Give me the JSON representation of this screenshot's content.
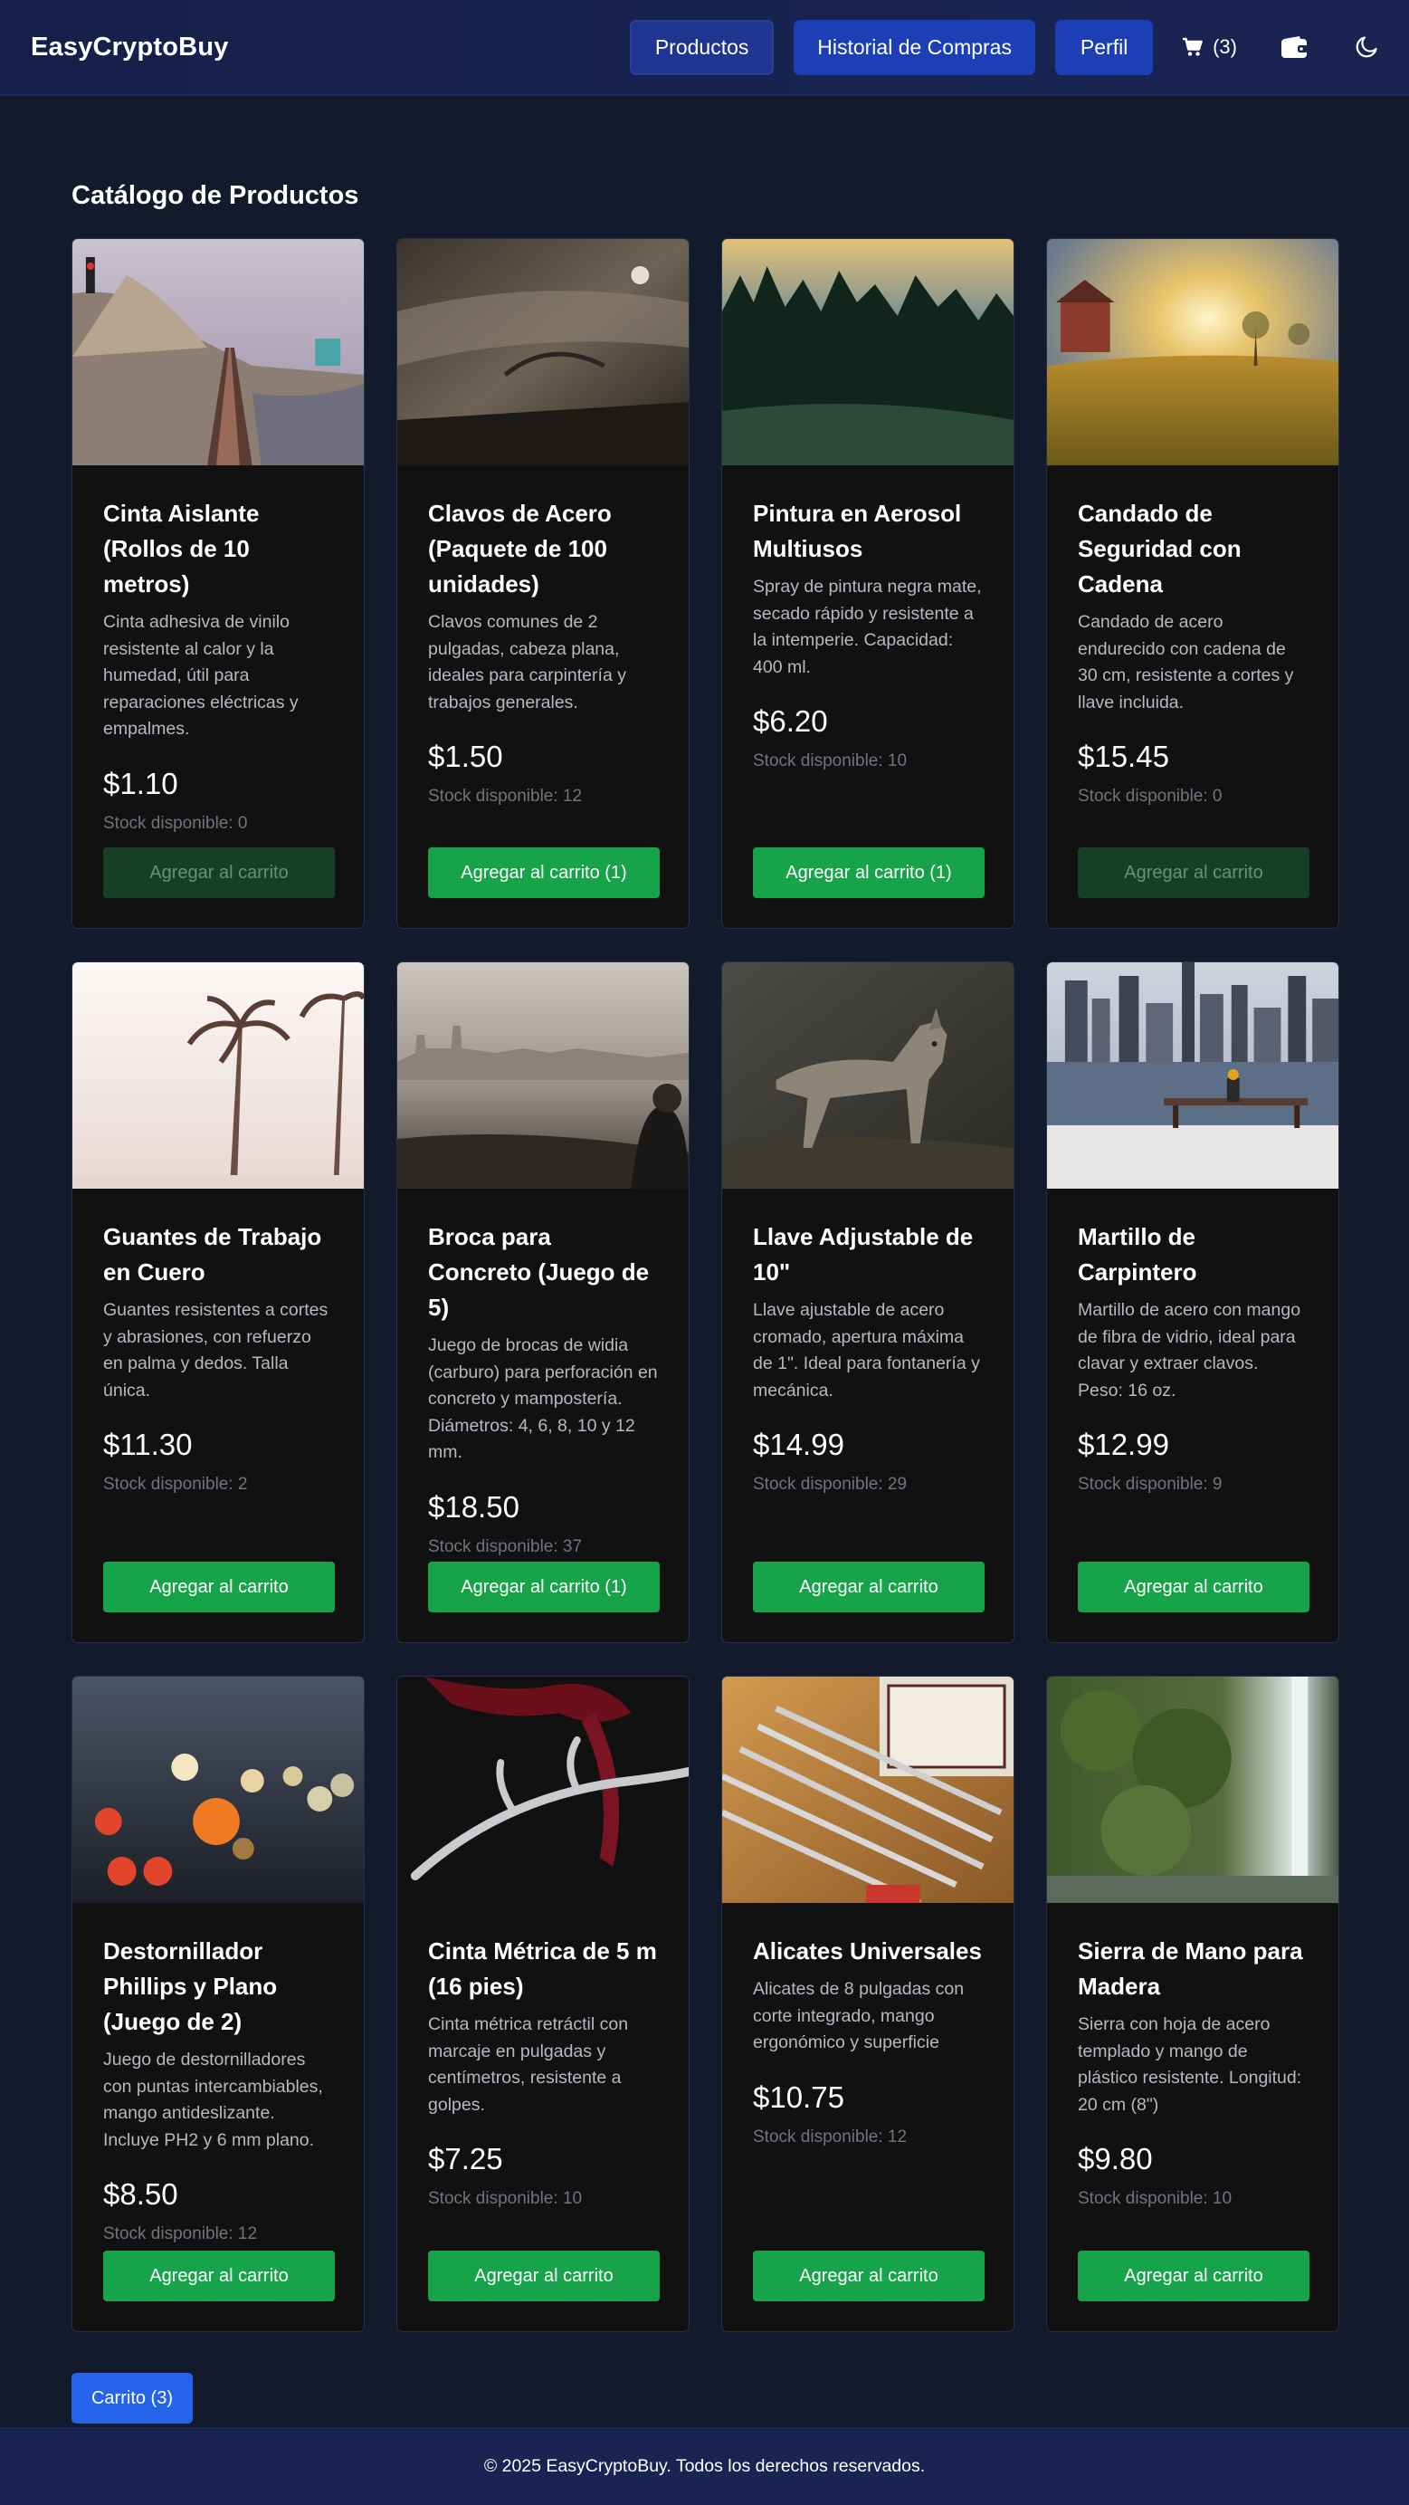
{
  "header": {
    "brand": "EasyCryptoBuy",
    "nav": {
      "products": "Productos",
      "history": "Historial de Compras",
      "profile": "Perfil"
    },
    "cart_count": "(3)",
    "cart_icon": "cart-icon",
    "wallet_icon": "wallet-icon",
    "theme_icon": "moon-icon"
  },
  "main": {
    "title": "Catálogo de Productos",
    "products": [
      {
        "name": "Cinta Aislante (Rollos de 10 metros)",
        "description": "Cinta adhesiva de vinilo resistente al calor y la humedad, útil para reparaciones eléctricas y empalmes.",
        "price": "$1.10",
        "stock": "Stock disponible: 0",
        "button": "Agregar al carrito",
        "disabled": true,
        "image": "railway-coast-photo"
      },
      {
        "name": "Clavos de Acero (Paquete de 100 unidades)",
        "description": "Clavos comunes de 2 pulgadas, cabeza plana, ideales para carpintería y trabajos generales.",
        "price": "$1.50",
        "stock": "Stock disponible: 12",
        "button": "Agregar al carrito (1)",
        "disabled": false,
        "image": "vintage-car-photo"
      },
      {
        "name": "Pintura en Aerosol Multiusos",
        "description": "Spray de pintura negra mate, secado rápido y resistente a la intemperie. Capacidad: 400 ml.",
        "price": "$6.20",
        "stock": "Stock disponible: 10",
        "button": "Agregar al carrito (1)",
        "disabled": false,
        "image": "forest-sunset-photo"
      },
      {
        "name": "Candado de Seguridad con Cadena",
        "description": "Candado de acero endurecido con cadena de 30 cm, resistente a cortes y llave incluida.",
        "price": "$15.45",
        "stock": "Stock disponible: 0",
        "button": "Agregar al carrito",
        "disabled": true,
        "image": "field-sunrise-photo"
      },
      {
        "name": "Guantes de Trabajo en Cuero",
        "description": "Guantes resistentes a cortes y abrasiones, con refuerzo en palma y dedos. Talla única.",
        "price": "$11.30",
        "stock": "Stock disponible: 2",
        "button": "Agregar al carrito",
        "disabled": false,
        "image": "palm-trees-photo"
      },
      {
        "name": "Broca para Concreto (Juego de 5)",
        "description": "Juego de brocas de widia (carburo) para perforación en concreto y mampostería. Diámetros: 4, 6, 8, 10 y 12 mm.",
        "price": "$18.50",
        "stock": "Stock disponible: 37",
        "button": "Agregar al carrito (1)",
        "disabled": false,
        "image": "city-shore-photo"
      },
      {
        "name": "Llave Adjustable de 10\"",
        "description": "Llave ajustable de acero cromado, apertura máxima de 1\". Ideal para fontanería y mecánica.",
        "price": "$14.99",
        "stock": "Stock disponible: 29",
        "button": "Agregar al carrito",
        "disabled": false,
        "image": "coyote-photo"
      },
      {
        "name": "Martillo de Carpintero",
        "description": "Martillo de acero con mango de fibra de vidrio, ideal para clavar y extraer clavos. Peso: 16 oz.",
        "price": "$12.99",
        "stock": "Stock disponible: 9",
        "button": "Agregar al carrito",
        "disabled": false,
        "image": "city-bench-photo"
      },
      {
        "name": "Destornillador Phillips y Plano (Juego de 2)",
        "description": "Juego de destornilladores con puntas intercambiables, mango antideslizante. Incluye PH2 y 6 mm plano.",
        "price": "$8.50",
        "stock": "Stock disponible: 12",
        "button": "Agregar al carrito",
        "disabled": false,
        "image": "bokeh-lights-photo"
      },
      {
        "name": "Cinta Métrica de 5 m (16 pies)",
        "description": "Cinta métrica retráctil con marcaje en pulgadas y centímetros, resistente a golpes.",
        "price": "$7.25",
        "stock": "Stock disponible: 10",
        "button": "Agregar al carrito",
        "disabled": false,
        "image": "antler-ribbon-photo"
      },
      {
        "name": "Alicates Universales",
        "description": "Alicates de 8 pulgadas con corte integrado, mango ergonómico y superficie",
        "price": "$10.75",
        "stock": "Stock disponible: 12",
        "button": "Agregar al carrito",
        "disabled": false,
        "image": "pens-sign-photo"
      },
      {
        "name": "Sierra de Mano para Madera",
        "description": "Sierra con hoja de acero templado y mango de plástico resistente. Longitud: 20 cm (8\")",
        "price": "$9.80",
        "stock": "Stock disponible: 10",
        "button": "Agregar al carrito",
        "disabled": false,
        "image": "waterfall-photo"
      }
    ]
  },
  "cart_button": "Carrito (3)",
  "footer": {
    "text": "© 2025 EasyCryptoBuy. Todos los derechos reservados."
  },
  "colors": {
    "background": "#131a2b",
    "navbar": "#17234f",
    "card": "#111111",
    "button_green": "#16a34a",
    "button_disabled": "#173f26",
    "cart_blue": "#2563eb"
  }
}
